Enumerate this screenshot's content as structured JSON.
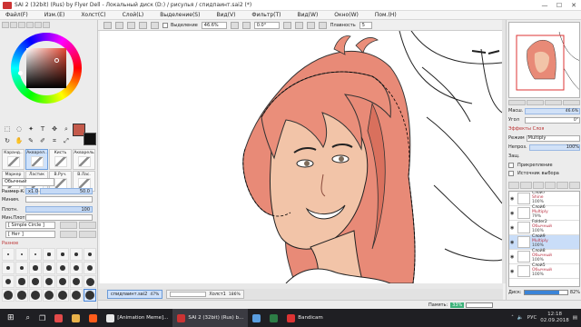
{
  "window": {
    "title": "SAI 2 (32bit) (Rus) by Flyer Dell - Локальный диск (D:) / рисулья / спидпаинт.sai2 (*)",
    "min": "—",
    "max": "☐",
    "close": "✕"
  },
  "menu": [
    "Файл(F)",
    "Изм.(E)",
    "Холст(C)",
    "Слой(L)",
    "Выделение(S)",
    "Вид(V)",
    "Фильтр(T)",
    "Вид(W)",
    "Окно(W)",
    "Пом.(H)"
  ],
  "canvas_toolbar": {
    "selection_label": "Выделение",
    "zoom": "46.6%",
    "angle": "0.0°",
    "smoothing_label": "Плавность",
    "smoothing_value": "5"
  },
  "tools": [
    {
      "label": "Каранд..",
      "selected": false
    },
    {
      "label": "Акварел..",
      "selected": true
    },
    {
      "label": "Кисть",
      "selected": false
    },
    {
      "label": "Акварель",
      "selected": false
    },
    {
      "label": "Маркер",
      "selected": false
    },
    {
      "label": "Ластик",
      "selected": false
    },
    {
      "label": "В.Руч.",
      "selected": false
    },
    {
      "label": "В.Лас.",
      "selected": false
    },
    {
      "label": "Заливка",
      "selected": false
    },
    {
      "label": "Двоичн..",
      "selected": false
    },
    {
      "label": "Градиент",
      "selected": false
    },
    {
      "label": "Размыв..",
      "selected": false
    }
  ],
  "brush": {
    "blend_mode": "Обычный",
    "size_label": "Размер К.",
    "size_mult": "x1.0",
    "size_value": "50.0",
    "min_size_label": "Миним.",
    "density_label": "Плотн.",
    "density_value": "100",
    "min_density_label": "Мин.Плотн.",
    "shape": "[ Simple Circle ]",
    "texture": "[ Нет ]",
    "group_label": "Разное",
    "sizes": [
      "1",
      "1.5",
      "2",
      "2.3",
      "2.6",
      "3",
      "3.5",
      "4",
      "5",
      "6",
      "7",
      "8",
      "9",
      "10",
      "12",
      "14",
      "16",
      "20",
      "25",
      "30",
      "35",
      "40",
      "50",
      "60",
      "70",
      "80",
      "100",
      "120"
    ],
    "selected_size_index": 27
  },
  "colors": {
    "primary": "#c45a4b",
    "secondary": "#111111",
    "hair": "#e88a77",
    "skin": "#f2c4a8"
  },
  "navigator": {
    "zoom_label": "Масш.",
    "zoom_value": "46.6%",
    "angle_label": "Угол",
    "angle_value": "0°"
  },
  "layer_panel": {
    "effects_header": "Эффекты Слоя",
    "mode_label": "Режим",
    "mode_value": "Multiply",
    "opacity_label": "Непроз.",
    "opacity_value": "100%",
    "protect_label": "Защ.",
    "clip_label": "Прикрепление",
    "source_label": "Источник выбора",
    "layers": [
      {
        "name": "Слой7",
        "mode": "Shine",
        "opacity": "100%",
        "selected": false
      },
      {
        "name": "Слой6",
        "mode": "Multiply",
        "opacity": "79%",
        "selected": false
      },
      {
        "name": "Folder2",
        "mode": "Обычный",
        "opacity": "100%",
        "selected": false
      },
      {
        "name": "Слой9",
        "mode": "Multiply",
        "opacity": "100%",
        "selected": true
      },
      {
        "name": "Слой8",
        "mode": "Обычный",
        "opacity": "100%",
        "selected": false
      },
      {
        "name": "Слой5",
        "mode": "Обычный",
        "opacity": "100%",
        "selected": false
      }
    ],
    "disk_label": "Диск:",
    "disk_value": "82%"
  },
  "documents": [
    {
      "name": "спидпаинт.sai2",
      "pct": "47%",
      "selected": true
    },
    {
      "name": "Холст1",
      "pct": "186%",
      "selected": false
    }
  ],
  "status": {
    "memory_label": "Память:",
    "memory_value": "33%"
  },
  "taskbar": {
    "items": [
      {
        "label": "",
        "color": "#e34a4a"
      },
      {
        "label": "",
        "color": "#e8b24a"
      },
      {
        "label": "",
        "color": "#ff5c1a"
      },
      {
        "label": "[Animation Meme]...",
        "color": "#e8e8e8"
      },
      {
        "label": "SAI 2 (32bit) (Rus) b...",
        "color": "#c33"
      },
      {
        "label": "",
        "color": "#5a9ee0"
      },
      {
        "label": "",
        "color": "#2d7d46"
      },
      {
        "label": "Bandicam",
        "color": "#d33"
      }
    ],
    "lang": "РУС",
    "time": "12:18",
    "date": "02.09.2018"
  }
}
